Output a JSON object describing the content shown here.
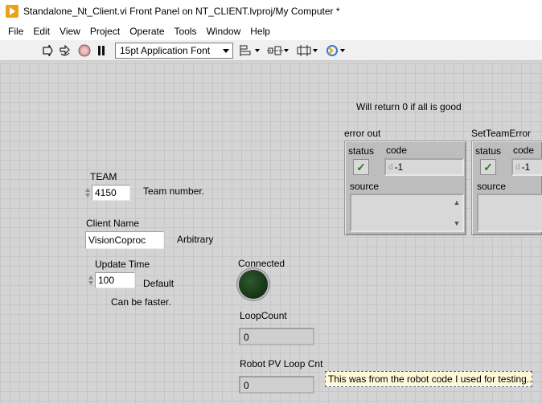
{
  "window": {
    "title": "Standalone_Nt_Client.vi Front Panel on NT_CLIENT.lvproj/My Computer *"
  },
  "menu": [
    "File",
    "Edit",
    "View",
    "Project",
    "Operate",
    "Tools",
    "Window",
    "Help"
  ],
  "toolbar": {
    "font": "15pt Application Font",
    "icons": [
      "run-arrow-icon",
      "run-continuously-icon",
      "abort-icon",
      "pause-icon",
      "align-objects-icon",
      "distribute-objects-icon",
      "resize-objects-icon",
      "reorder-icon"
    ]
  },
  "panel": {
    "note_top": "Will return 0 if all is good",
    "team": {
      "label": "TEAM",
      "value": "4150",
      "caption": "Team number."
    },
    "client_name": {
      "label": "Client Name",
      "value": "VisionCoproc",
      "caption": "Arbitrary"
    },
    "update_time": {
      "label": "Update Time",
      "value": "100",
      "caption": "Default",
      "note": "Can be faster."
    },
    "connected": {
      "label": "Connected",
      "color": "#1e3f1e"
    },
    "loop_count": {
      "label": "LoopCount",
      "value": "0"
    },
    "robot_pv": {
      "label": "Robot PV Loop Cnt",
      "value": "0"
    },
    "comment": "This was from the robot code I used for testing..."
  },
  "error_out": {
    "label": "error out",
    "status_label": "status",
    "code_label": "code",
    "code_value": "-1",
    "code_prefix": "d",
    "source_label": "source",
    "status_glyph": "✓"
  },
  "set_team_error": {
    "label": "SetTeamError",
    "status_label": "status",
    "code_label": "code",
    "code_value": "-1",
    "code_prefix": "d",
    "source_label": "source",
    "status_glyph": "✓"
  }
}
